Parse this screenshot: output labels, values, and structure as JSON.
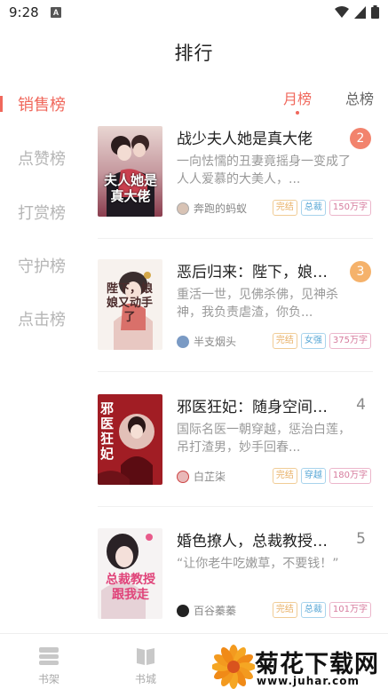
{
  "status_bar": {
    "time": "9:28",
    "notification_letter": "A"
  },
  "header": {
    "title": "排行"
  },
  "categories": [
    {
      "label": "销售榜",
      "active": true
    },
    {
      "label": "点赞榜",
      "active": false
    },
    {
      "label": "打赏榜",
      "active": false
    },
    {
      "label": "守护榜",
      "active": false
    },
    {
      "label": "点击榜",
      "active": false
    }
  ],
  "tabs": [
    {
      "label": "月榜",
      "active": true
    },
    {
      "label": "总榜",
      "active": false
    }
  ],
  "books": [
    {
      "title": "战少夫人她是真大佬",
      "description": "一向怯懦的丑妻竟摇身一变成了人人爱慕的大美人，...",
      "author": "奔跑的蚂蚁",
      "rank": "2",
      "tags": [
        "完结",
        "总裁",
        "150万字"
      ],
      "cover_text": "夫人她是真大佬"
    },
    {
      "title": "恶后归来：陛下，娘娘要...",
      "description": "重活一世，见佛杀佛，见神杀神，我负责虐渣，你负...",
      "author": "半支烟头",
      "rank": "3",
      "tags": [
        "完结",
        "女强",
        "375万字"
      ],
      "cover_text": "陛下，娘娘又动手了"
    },
    {
      "title": "邪医狂妃：随身空间有...",
      "description": "国际名医一朝穿越，惩治白莲，吊打渣男，妙手回春...",
      "author": "白芷柒",
      "rank": "4",
      "tags": [
        "完结",
        "穿越",
        "180万字"
      ],
      "cover_text": "邪医狂妃"
    },
    {
      "title": "婚色撩人，总裁教授跟我...",
      "description": "“让你老牛吃嫩草，不要钱！”",
      "author": "百谷蓁蓁",
      "rank": "5",
      "tags": [
        "完结",
        "总裁",
        "101万字"
      ],
      "cover_text": "总裁教授跟我走"
    }
  ],
  "bottom_nav": [
    {
      "label": "书架",
      "icon": "bookshelf-icon"
    },
    {
      "label": "书城",
      "icon": "book-city-icon"
    }
  ],
  "watermark": {
    "text": "菊花下载网",
    "url": "www.juhar.com"
  },
  "colors": {
    "accent": "#f0685c",
    "rank2": "#f2836d",
    "rank3": "#f5b26b"
  }
}
